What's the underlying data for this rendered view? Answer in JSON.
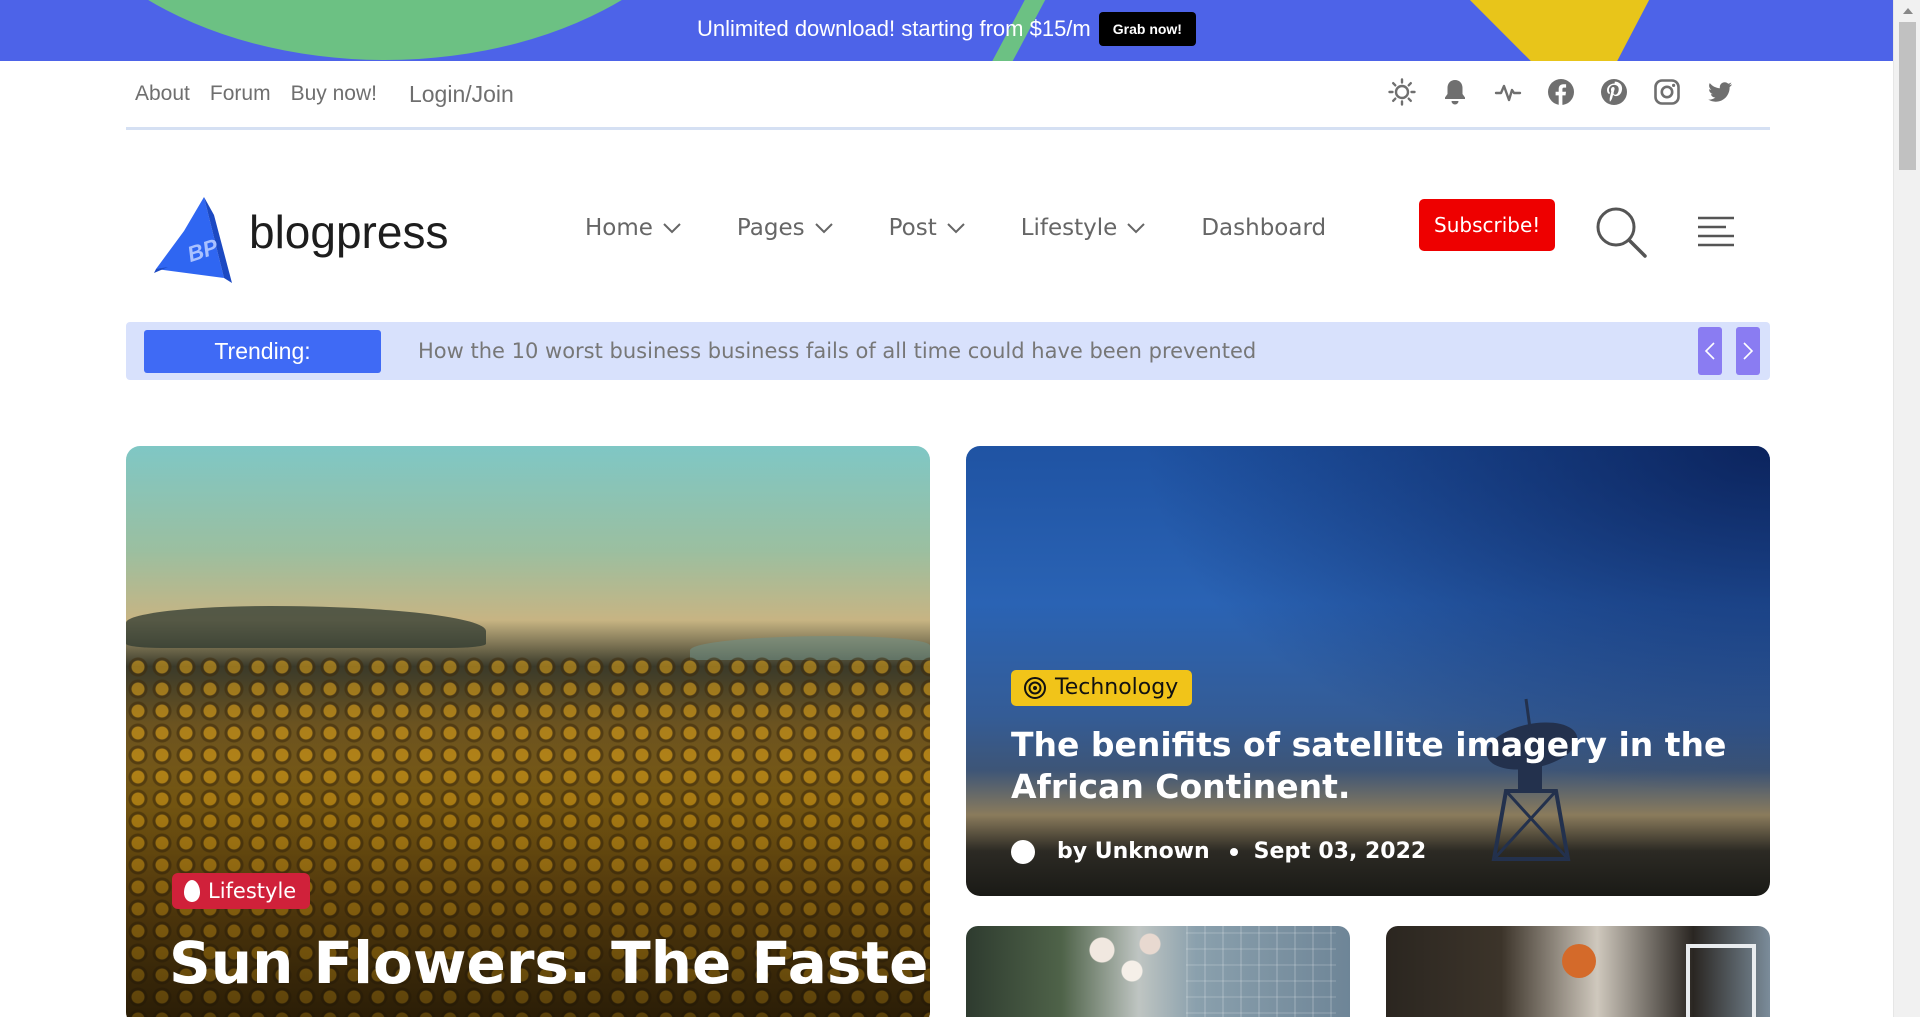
{
  "promo": {
    "text": "Unlimited download! starting from $15/m",
    "button": "Grab now!"
  },
  "topbar": {
    "links": [
      "About",
      "Forum",
      "Buy now!"
    ],
    "login": "Login/Join",
    "icons": [
      "sun-icon",
      "bell-icon",
      "activity-icon",
      "facebook-icon",
      "pinterest-icon",
      "instagram-icon",
      "twitter-icon"
    ]
  },
  "header": {
    "brand": "blogpress",
    "logo_text": "BP",
    "nav": [
      {
        "label": "Home",
        "dropdown": true
      },
      {
        "label": "Pages",
        "dropdown": true
      },
      {
        "label": "Post",
        "dropdown": true
      },
      {
        "label": "Lifestyle",
        "dropdown": true
      },
      {
        "label": "Dashboard",
        "dropdown": false
      }
    ],
    "subscribe": "Subscribe!"
  },
  "trending": {
    "label": "Trending:",
    "headline": "How the 10 worst business business fails of all time could have been prevented"
  },
  "featured_left": {
    "category": "Lifestyle",
    "title": "Sun Flowers. The Fastest"
  },
  "featured_right": {
    "category": "Technology",
    "title": "The benifits of satellite imagery in the African Continent.",
    "author": "by Unknown",
    "date": "Sept 03, 2022"
  },
  "colors": {
    "promo_bg": "#4d63e8",
    "accent_blue": "#3f6af5",
    "subscribe_red": "#ee0000",
    "lifestyle_red": "#d0213a",
    "technology_yellow": "#f1c419",
    "trending_bg": "#d8e1fc"
  }
}
